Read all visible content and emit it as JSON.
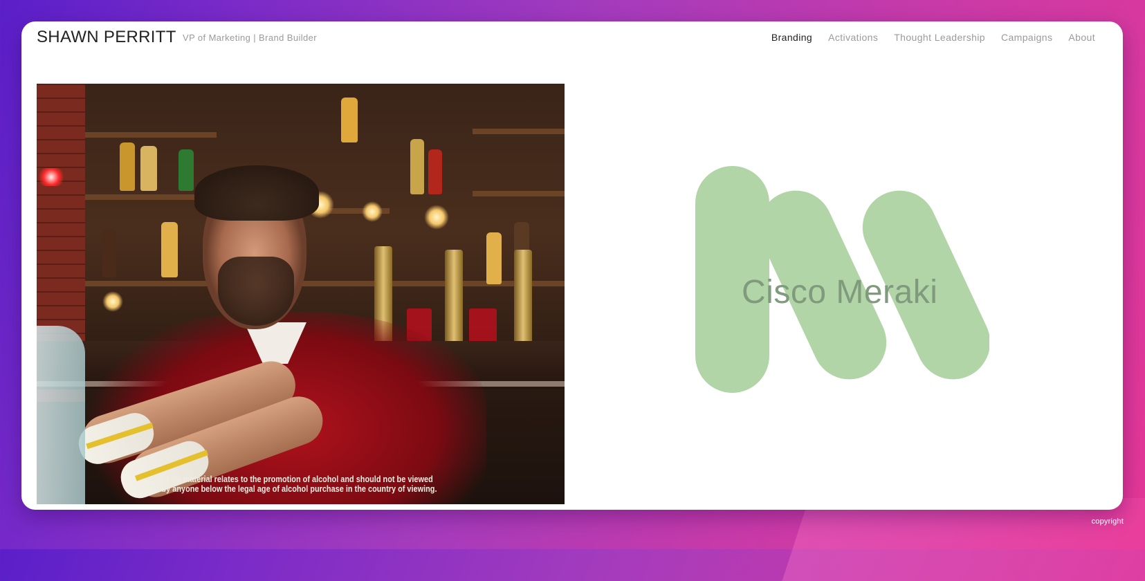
{
  "header": {
    "name": "SHAWN PERRITT",
    "tagline": "VP of Marketing | Brand Builder"
  },
  "nav": {
    "items": [
      {
        "label": "Branding",
        "active": true
      },
      {
        "label": "Activations",
        "active": false
      },
      {
        "label": "Thought Leadership",
        "active": false
      },
      {
        "label": "Campaigns",
        "active": false
      },
      {
        "label": "About",
        "active": false
      }
    ]
  },
  "video": {
    "disclaimer_line1": "This material relates to the promotion of alcohol and should not be viewed",
    "disclaimer_line2": "by anyone below the legal age of alcohol purchase in the country of viewing."
  },
  "project": {
    "logo_icon": "meraki-m-icon",
    "title": "Cisco Meraki",
    "logo_color": "#b1d5a7",
    "title_color": "#7f9a7c"
  },
  "footer": {
    "copyright": "copyright"
  },
  "colors": {
    "background_gradient_start": "#5a1fc9",
    "background_gradient_end": "#e53796",
    "card": "#ffffff",
    "nav_active": "#222222",
    "nav_inactive": "#9a9a9a"
  }
}
